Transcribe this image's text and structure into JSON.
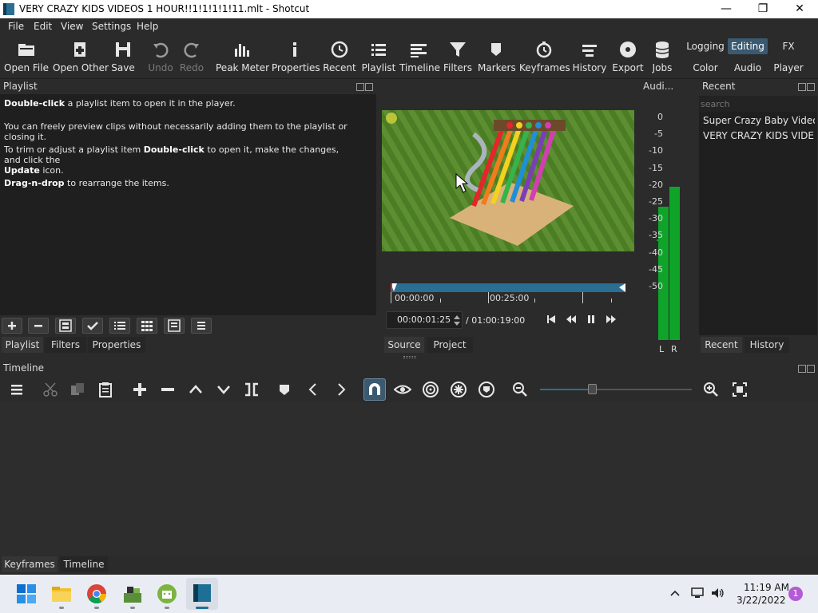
{
  "window": {
    "title": "VERY CRAZY KIDS VIDEOS 1 HOUR!!1!1!1!1!11.mlt - Shotcut"
  },
  "menu": [
    "File",
    "Edit",
    "View",
    "Settings",
    "Help"
  ],
  "toolbar": {
    "open_file": "Open File",
    "open_other": "Open Other",
    "save": "Save",
    "undo": "Undo",
    "redo": "Redo",
    "peak_meter": "Peak Meter",
    "properties": "Properties",
    "recent": "Recent",
    "playlist": "Playlist",
    "timeline": "Timeline",
    "filters": "Filters",
    "markers": "Markers",
    "keyframes": "Keyframes",
    "history": "History",
    "export": "Export",
    "jobs": "Jobs"
  },
  "layouts": {
    "logging": "Logging",
    "editing": "Editing",
    "fx": "FX",
    "color": "Color",
    "audio": "Audio",
    "player": "Player"
  },
  "playlist_panel": {
    "title": "Playlist",
    "help1_bold": "Double-click",
    "help1_rest": " a playlist item to open it in the player.",
    "help2": "You can freely preview clips without necessarily adding them to the playlist or closing it.",
    "help3_a": "To trim or adjust a playlist item ",
    "help3_bold": "Double-click",
    "help3_b": " to open it, make the changes, and click the",
    "help3_bold2": "Update",
    "help3_c": " icon.",
    "help4_bold": "Drag-n-drop",
    "help4_rest": " to rearrange the items.",
    "tabs": [
      "Playlist",
      "Filters",
      "Properties"
    ]
  },
  "player": {
    "ruler_start": "00:00:00",
    "ruler_mid": "00:25:00",
    "position": "00:00:01:25",
    "duration": "/ 01:00:19:00",
    "tabs": [
      "Source",
      "Project"
    ]
  },
  "audio_panel": {
    "title": "Audi...",
    "scale": [
      "0",
      "-5",
      "-10",
      "-15",
      "-20",
      "-25",
      "-30",
      "-35",
      "-40",
      "-45",
      "-50"
    ],
    "left_label": "L",
    "right_label": "R",
    "left_level_db": -27,
    "right_level_db": -21
  },
  "recent_panel": {
    "title": "Recent",
    "search_placeholder": "search",
    "items": [
      "Super Crazy Baby Video...",
      "VERY CRAZY KIDS VIDE..."
    ],
    "tabs": [
      "Recent",
      "History"
    ]
  },
  "timeline_panel": {
    "title": "Timeline",
    "tabs": [
      "Keyframes",
      "Timeline"
    ]
  },
  "taskbar": {
    "time": "11:19 AM",
    "date": "3/22/2022",
    "notification_count": "1"
  },
  "colors": {
    "accent": "#2a6f93",
    "meter_green": "#0fa32a",
    "active_layout": "#3b5a70"
  }
}
